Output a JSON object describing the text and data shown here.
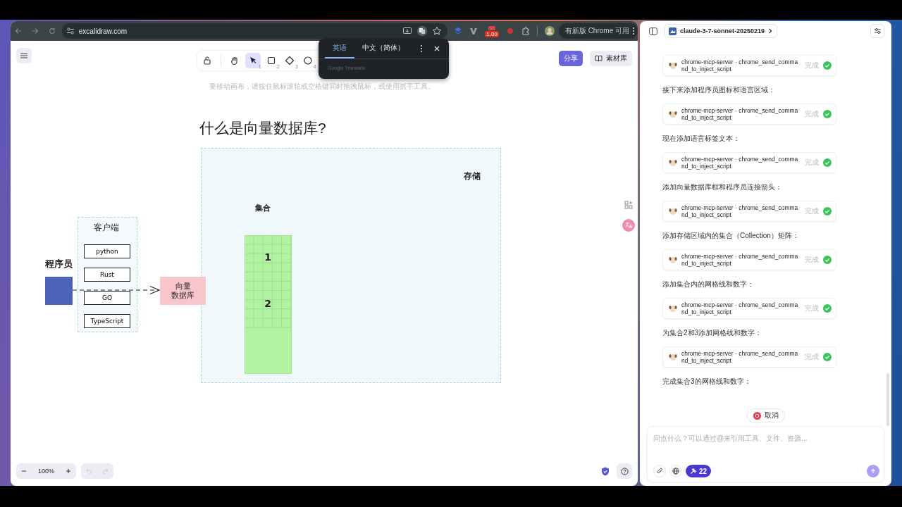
{
  "browser": {
    "url": "excalidraw.com",
    "extension_badge": "1.00",
    "update_notice": "有新版 Chrome 可用"
  },
  "translate_popup": {
    "tabs": [
      {
        "label": "英语",
        "selected": true
      },
      {
        "label": "中文（简体）",
        "selected": false
      }
    ],
    "footer": "Google Translate"
  },
  "excalidraw": {
    "toolbar": [
      {
        "kind": "lock",
        "selected": false
      },
      {
        "kind": "hand",
        "selected": false
      },
      {
        "kind": "select",
        "shortcut": "1",
        "selected": true
      },
      {
        "kind": "rectangle",
        "shortcut": "2",
        "selected": false
      },
      {
        "kind": "diamond",
        "shortcut": "3",
        "selected": false
      },
      {
        "kind": "ellipse",
        "shortcut": "4",
        "selected": false
      }
    ],
    "hint": "要移动画布，请按住鼠标滚轮或空格键同时拖拽鼠标，或使用抓手工具。",
    "share_button": "分享",
    "library_button": "素材库",
    "zoom": "100%",
    "can_undo": false,
    "can_redo": false,
    "canvas": {
      "title": "什么是向量数据库?",
      "storage": {
        "label": "存储"
      },
      "collection": {
        "label": "集合",
        "numbers": [
          "1",
          "2"
        ]
      },
      "client": {
        "label": "客户端",
        "languages": [
          "python",
          "Rust",
          "GO",
          "TypeScript"
        ]
      },
      "programmer": {
        "label": "程序员"
      },
      "database": {
        "lines": [
          "向量",
          "数据库"
        ]
      }
    }
  },
  "chat": {
    "model": "claude-3-7-sonnet-20250219",
    "messages": [
      {
        "kind": "tool",
        "label": "chrome-mcp-server · chrome_send_command_to_inject_script",
        "status": "完成",
        "done": true
      },
      {
        "kind": "text",
        "text": "接下来添加程序员图标和语言区域："
      },
      {
        "kind": "tool",
        "label": "chrome-mcp-server · chrome_send_command_to_inject_script",
        "status": "完成",
        "done": true
      },
      {
        "kind": "text",
        "text": "现在添加语言标签文本："
      },
      {
        "kind": "tool",
        "label": "chrome-mcp-server · chrome_send_command_to_inject_script",
        "status": "完成",
        "done": true
      },
      {
        "kind": "text",
        "text": "添加向量数据库框和程序员连接箭头："
      },
      {
        "kind": "tool",
        "label": "chrome-mcp-server · chrome_send_command_to_inject_script",
        "status": "完成",
        "done": true
      },
      {
        "kind": "text",
        "text": "添加存储区域内的集合（Collection）矩阵："
      },
      {
        "kind": "tool",
        "label": "chrome-mcp-server · chrome_send_command_to_inject_script",
        "status": "完成",
        "done": true
      },
      {
        "kind": "text",
        "text": "添加集合内的网格线和数字："
      },
      {
        "kind": "tool",
        "label": "chrome-mcp-server · chrome_send_command_to_inject_script",
        "status": "完成",
        "done": true
      },
      {
        "kind": "text",
        "text": "为集合2和3添加网格线和数字："
      },
      {
        "kind": "tool",
        "label": "chrome-mcp-server · chrome_send_command_to_inject_script",
        "status": "完成",
        "done": true
      },
      {
        "kind": "text",
        "text": "完成集合3的网格线和数字："
      }
    ],
    "cancel_button": "取消",
    "input": {
      "placeholder": "问点什么？可以通过@来引用工具、文件、资源..."
    },
    "tools_count": "22"
  }
}
